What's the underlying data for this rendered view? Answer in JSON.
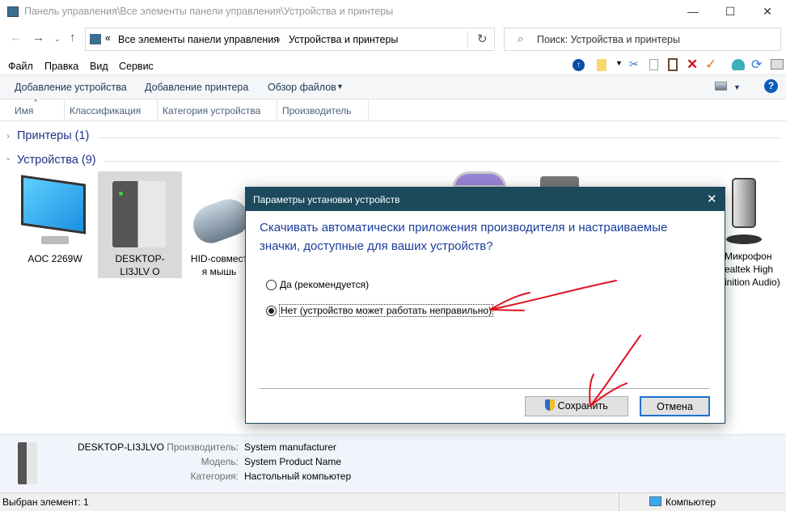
{
  "window": {
    "title": "Панель управления\\Все элементы панели управления\\Устройства и принтеры"
  },
  "address": {
    "prefix": "«",
    "crumbs": [
      "Все элементы панели управления",
      "Устройства и принтеры"
    ]
  },
  "search": {
    "placeholder": "Поиск: Устройства и принтеры"
  },
  "menu": [
    "Файл",
    "Правка",
    "Вид",
    "Сервис"
  ],
  "commands": {
    "add_device": "Добавление устройства",
    "add_printer": "Добавление принтера",
    "browse": "Обзор файлов"
  },
  "columns": [
    "Имя",
    "Классификация",
    "Категория устройства",
    "Производитель"
  ],
  "groups": {
    "printers": "Принтеры (1)",
    "devices": "Устройства (9)"
  },
  "devices": [
    {
      "name": "AOC 2269W"
    },
    {
      "name": "DESKTOP-LI3JLV O"
    },
    {
      "name": "HID-совмест я мышь"
    },
    {
      "name": "Микрофон ealtek High inition Audio)"
    }
  ],
  "details": {
    "name": "DESKTOP-LI3JLVO",
    "rows": [
      {
        "k": "Производитель:",
        "v": "System manufacturer"
      },
      {
        "k": "Модель:",
        "v": "System Product Name"
      },
      {
        "k": "Категория:",
        "v": "Настольный компьютер"
      }
    ]
  },
  "status": {
    "left": "Выбран элемент: 1",
    "right": "Компьютер"
  },
  "dialog": {
    "title": "Параметры установки устройств",
    "question_l1": "Скачивать автоматически приложения производителя и настраиваемые",
    "question_l2": "значки, доступные для ваших устройств?",
    "options": [
      {
        "label": "Да (рекомендуется)",
        "selected": false
      },
      {
        "label": "Нет (устройство может работать неправильно)",
        "selected": true
      }
    ],
    "save": "Сохранить",
    "cancel": "Отмена"
  },
  "colors": {
    "dialog_title": "#1c4a5c",
    "question": "#1a3d9c",
    "annotation": "#e0131f"
  }
}
